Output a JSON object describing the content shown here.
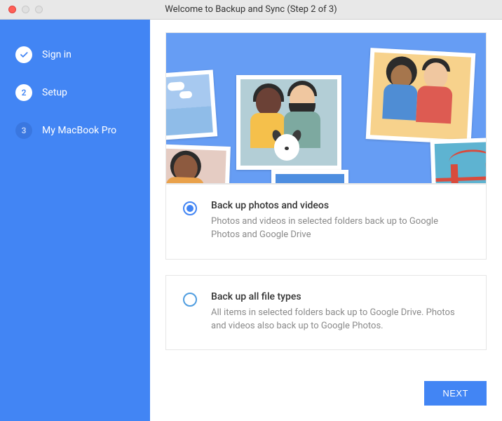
{
  "window": {
    "title": "Welcome to Backup and Sync (Step 2 of 3)"
  },
  "sidebar": {
    "steps": [
      {
        "label": "Sign in",
        "state": "done"
      },
      {
        "label": "Setup",
        "state": "current",
        "number": "2"
      },
      {
        "label": "My MacBook Pro",
        "state": "upcoming",
        "number": "3"
      }
    ]
  },
  "options": [
    {
      "selected": true,
      "title": "Back up photos and videos",
      "description": "Photos and videos in selected folders back up to Google Photos and Google Drive"
    },
    {
      "selected": false,
      "title": "Back up all file types",
      "description": "All items in selected folders back up to Google Drive. Photos and videos also back up to Google Photos."
    }
  ],
  "footer": {
    "next_label": "NEXT"
  }
}
